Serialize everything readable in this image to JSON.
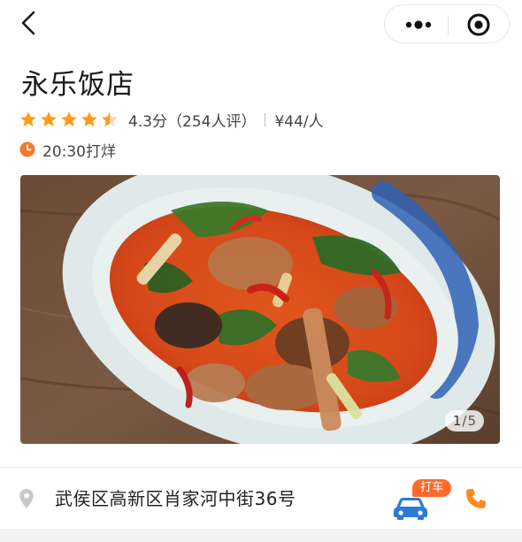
{
  "nav": {
    "back_icon": "chevron-left-icon",
    "more_icon": "more-dots-icon",
    "close_icon": "target-circle-icon"
  },
  "restaurant": {
    "name": "永乐饭店",
    "rating_stars": 4.5,
    "rating_text": "4.3分（254人评）",
    "price": "¥44/人",
    "closing_time": "20:30打烊"
  },
  "gallery": {
    "current": "1",
    "total": "5"
  },
  "address": {
    "text": "武侯区高新区肖家河中街36号",
    "taxi_label": "打车"
  },
  "colors": {
    "accent": "#ff8a1e",
    "star": "#ff9a1a",
    "taxi_badge": "#ff6a2b",
    "taxi_car": "#2b7bd6",
    "clock": "#f07a2e"
  }
}
